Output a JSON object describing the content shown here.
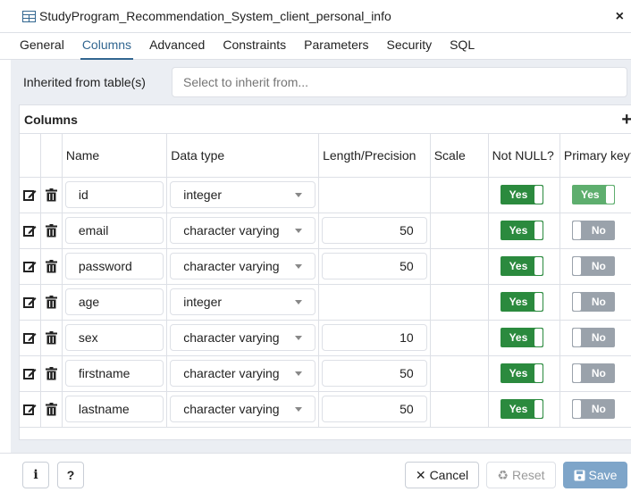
{
  "window": {
    "title": "StudyProgram_Recommendation_System_client_personal_info",
    "close_label": "×"
  },
  "tabs": [
    {
      "label": "General",
      "active": false
    },
    {
      "label": "Columns",
      "active": true
    },
    {
      "label": "Advanced",
      "active": false
    },
    {
      "label": "Constraints",
      "active": false
    },
    {
      "label": "Parameters",
      "active": false
    },
    {
      "label": "Security",
      "active": false
    },
    {
      "label": "SQL",
      "active": false
    }
  ],
  "inherit": {
    "label": "Inherited from table(s)",
    "placeholder": "Select to inherit from..."
  },
  "columns_panel": {
    "title": "Columns",
    "add_label": "+",
    "headers": {
      "name": "Name",
      "data_type": "Data type",
      "length": "Length/Precision",
      "scale": "Scale",
      "not_null": "Not NULL?",
      "primary_key": "Primary key?"
    },
    "rows": [
      {
        "name": "id",
        "data_type": "integer",
        "length": "",
        "scale": "",
        "not_null": "Yes",
        "primary_key": "Yes"
      },
      {
        "name": "email",
        "data_type": "character varying",
        "length": "50",
        "scale": "",
        "not_null": "Yes",
        "primary_key": "No"
      },
      {
        "name": "password",
        "data_type": "character varying",
        "length": "50",
        "scale": "",
        "not_null": "Yes",
        "primary_key": "No"
      },
      {
        "name": "age",
        "data_type": "integer",
        "length": "",
        "scale": "",
        "not_null": "Yes",
        "primary_key": "No"
      },
      {
        "name": "sex",
        "data_type": "character varying",
        "length": "10",
        "scale": "",
        "not_null": "Yes",
        "primary_key": "No"
      },
      {
        "name": "firstname",
        "data_type": "character varying",
        "length": "50",
        "scale": "",
        "not_null": "Yes",
        "primary_key": "No"
      },
      {
        "name": "lastname",
        "data_type": "character varying",
        "length": "50",
        "scale": "",
        "not_null": "Yes",
        "primary_key": "No"
      }
    ]
  },
  "footer": {
    "info_label": "i",
    "help_label": "?",
    "cancel_label": "Cancel",
    "reset_label": "Reset",
    "save_label": "Save"
  },
  "colors": {
    "accent": "#326690",
    "toggle_on": "#2b8a3e",
    "toggle_off": "#9aa2ab",
    "save": "#7ea5c9"
  }
}
